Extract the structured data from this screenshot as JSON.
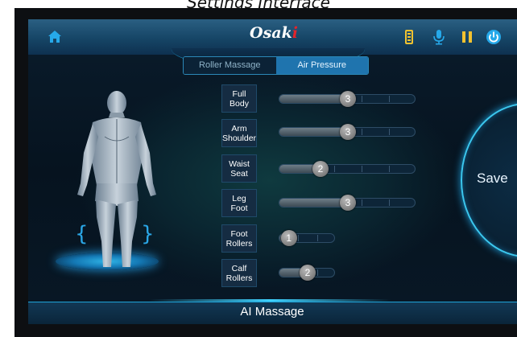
{
  "caption": "Settings Interface",
  "header": {
    "brand_main": "Osak",
    "brand_accent": "i",
    "icons": [
      "home-icon",
      "battery-icon",
      "microphone-icon",
      "pause-icon",
      "power-icon"
    ]
  },
  "tabs": [
    {
      "label": "Roller Massage",
      "active": false
    },
    {
      "label": "Air Pressure",
      "active": true
    }
  ],
  "rows": [
    {
      "line1": "Full",
      "line2": "Body",
      "level": 3,
      "max": 5
    },
    {
      "line1": "Arm",
      "line2": "Shoulder",
      "level": 3,
      "max": 5
    },
    {
      "line1": "Waist",
      "line2": "Seat",
      "level": 2,
      "max": 5
    },
    {
      "line1": "Leg",
      "line2": "Foot",
      "level": 3,
      "max": 5
    },
    {
      "line1": "Foot",
      "line2": "Rollers",
      "level": 1,
      "max": 3
    },
    {
      "line1": "Calf",
      "line2": "Rollers",
      "level": 2,
      "max": 3
    }
  ],
  "save_label": "Save",
  "bottom_label": "AI Massage",
  "colors": {
    "accent": "#1ea3d8",
    "brand_red": "#e3242b",
    "icon_blue": "#26a9ea",
    "icon_yellow": "#f2c230",
    "tab_active": "#1f74ae"
  }
}
